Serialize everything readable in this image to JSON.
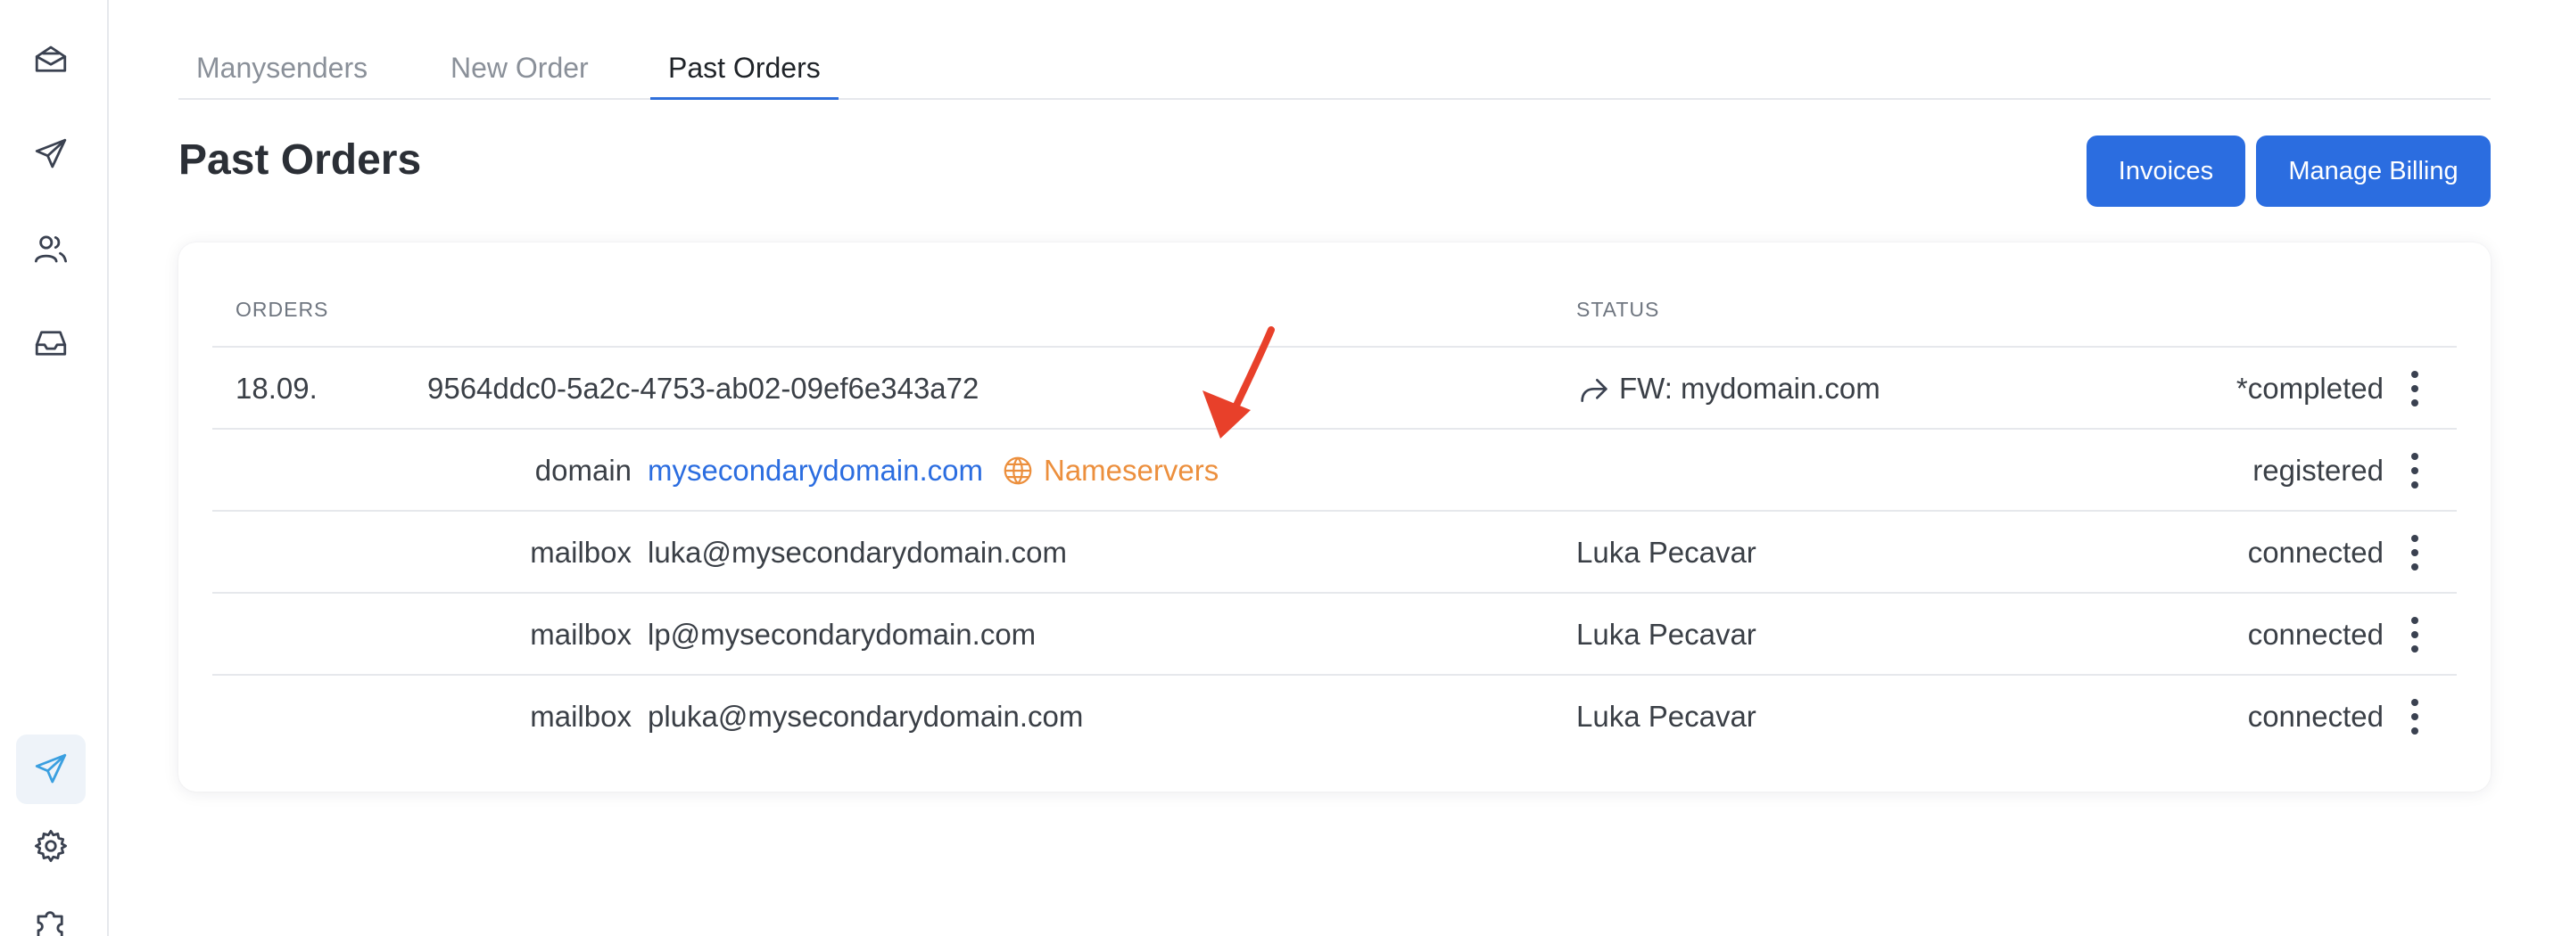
{
  "sidebar": {
    "icons": [
      "mail-open-icon",
      "send-icon",
      "users-icon",
      "inbox-icon",
      "send-active-icon",
      "gear-icon",
      "puzzle-icon"
    ]
  },
  "tabs": [
    {
      "label": "Manysenders"
    },
    {
      "label": "New Order"
    },
    {
      "label": "Past Orders",
      "active": true
    }
  ],
  "page": {
    "title": "Past Orders",
    "invoices_label": "Invoices",
    "manage_billing_label": "Manage Billing"
  },
  "table": {
    "headers": {
      "orders": "ORDERS",
      "status": "STATUS"
    },
    "order": {
      "date": "18.09.",
      "id": "9564ddc0-5a2c-4753-ab02-09ef6e343a72",
      "subject": "FW: mydomain.com",
      "status": "*completed"
    },
    "items": [
      {
        "type": "domain",
        "value": "mysecondarydomain.com",
        "extra": "Nameservers",
        "owner": "",
        "status": "registered"
      },
      {
        "type": "mailbox",
        "value": "luka@mysecondarydomain.com",
        "owner": "Luka Pecavar",
        "status": "connected"
      },
      {
        "type": "mailbox",
        "value": "lp@mysecondarydomain.com",
        "owner": "Luka Pecavar",
        "status": "connected"
      },
      {
        "type": "mailbox",
        "value": "pluka@mysecondarydomain.com",
        "owner": "Luka Pecavar",
        "status": "connected"
      }
    ]
  },
  "colors": {
    "accent": "#2b6de0",
    "nameservers": "#ec8f3d",
    "annotation_arrow": "#e8402a"
  }
}
